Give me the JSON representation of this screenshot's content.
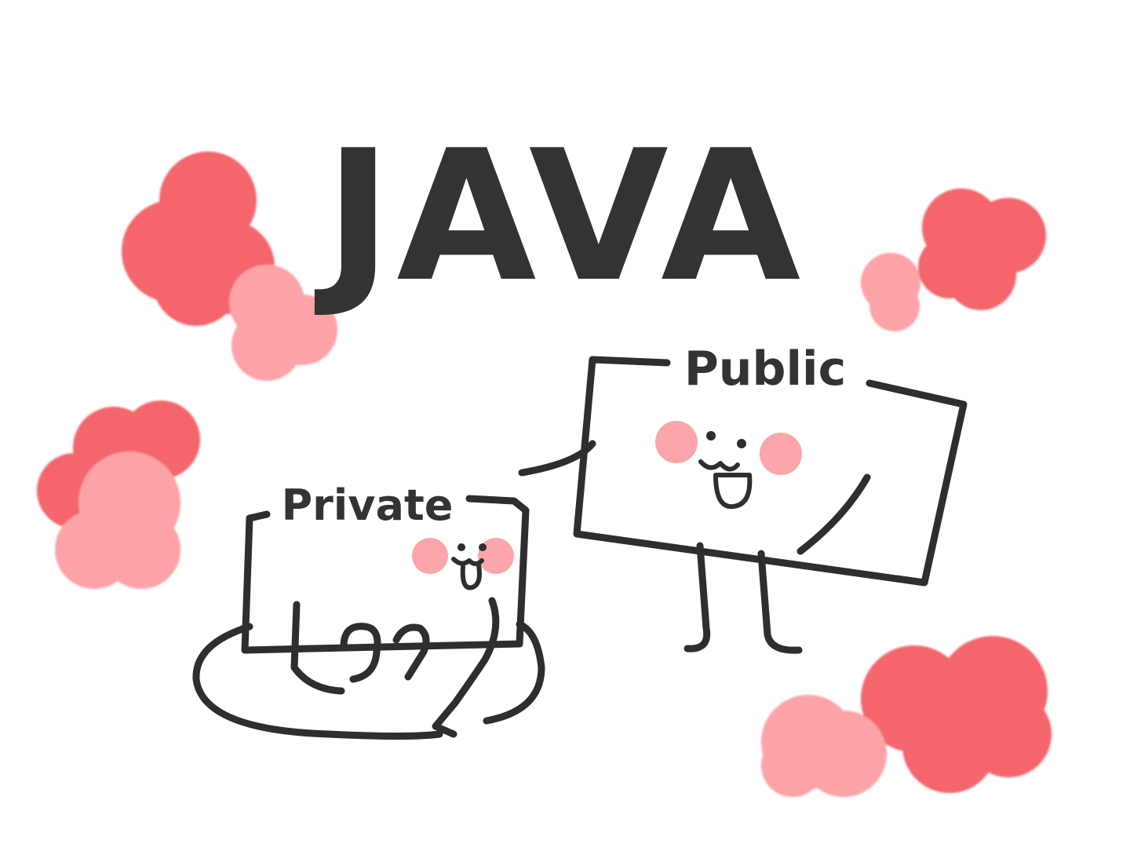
{
  "title": "JAVA",
  "characters": {
    "public_label": "Public",
    "private_label": "Private"
  },
  "colors": {
    "ink": "#2e2e2e",
    "blob_dark": "#f4656c",
    "blob_light": "#fca3a7",
    "blush": "#fba6aa",
    "background": "#ffffff"
  }
}
